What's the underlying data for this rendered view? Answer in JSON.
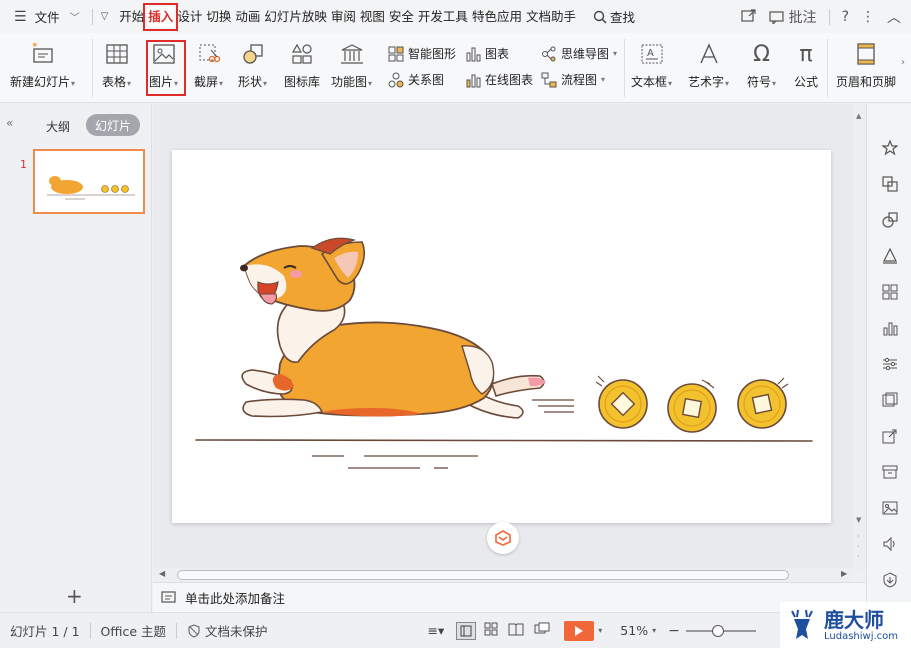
{
  "menu": {
    "file_label": "文件",
    "tabs": [
      "开始",
      "插入",
      "设计",
      "切换",
      "动画",
      "幻灯片放映",
      "审阅",
      "视图",
      "安全",
      "开发工具",
      "特色应用",
      "文档助手"
    ],
    "active_tab": "插入",
    "search_label": "查找",
    "annotate_label": "批注"
  },
  "ribbon": {
    "new_slide": "新建幻灯片",
    "table": "表格",
    "picture": "图片",
    "screenshot": "截屏",
    "shape": "形状",
    "icon_lib": "图标库",
    "func_chart": "功能图",
    "smart_art": "智能图形",
    "chart": "图表",
    "relation": "关系图",
    "online_chart": "在线图表",
    "mind_map": "思维导图",
    "flowchart": "流程图",
    "textbox": "文本框",
    "wordart": "艺术字",
    "symbol": "符号",
    "formula": "公式",
    "header_footer": "页眉和页脚"
  },
  "left_panel": {
    "outline_tab": "大纲",
    "slides_tab": "幻灯片",
    "slide_number": "1"
  },
  "notes": {
    "placeholder": "单击此处添加备注"
  },
  "status": {
    "slide_info": "幻灯片 1 / 1",
    "theme": "Office 主题",
    "protection": "文档未保护",
    "zoom": "51%"
  },
  "watermark": {
    "title": "鹿大师",
    "url": "Ludashiwj.com"
  },
  "colors": {
    "accent_red": "#e02b2b",
    "play_orange": "#f0683a",
    "thumb_border": "#f08b4b",
    "corgi_orange": "#f2a531",
    "coin_gold": "#f2c22e"
  }
}
